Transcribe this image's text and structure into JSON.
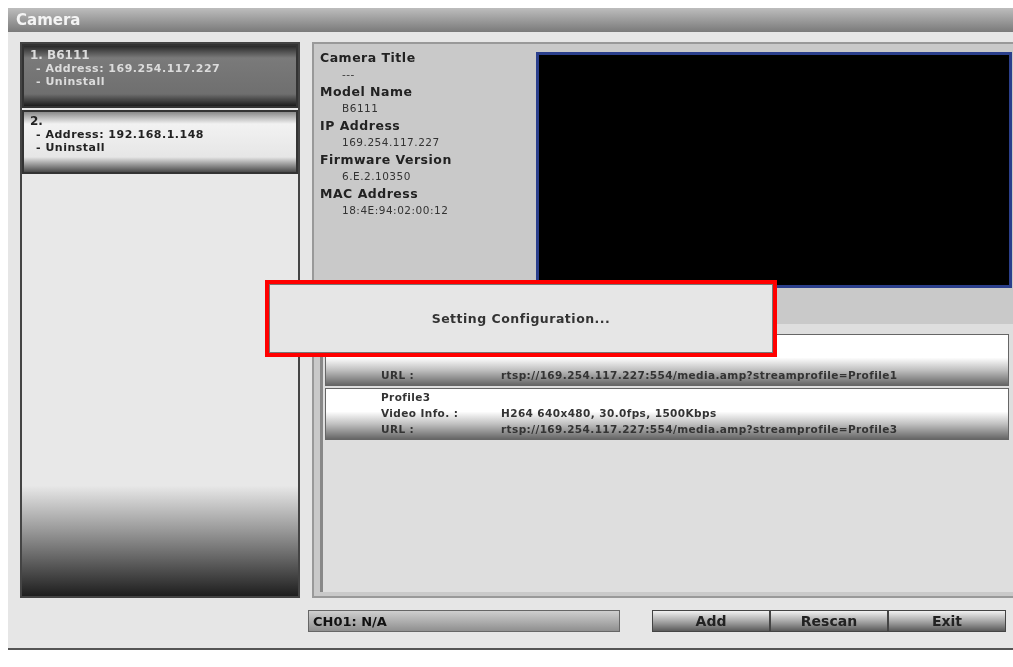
{
  "window": {
    "title": "Camera"
  },
  "cameras": [
    {
      "name": "1. B6111",
      "address": "- Address: 169.254.117.227",
      "action": "- Uninstall",
      "selected": true
    },
    {
      "name": "2.",
      "address": "- Address: 192.168.1.148",
      "action": "- Uninstall",
      "selected": false
    }
  ],
  "details": [
    {
      "label": "Camera Title",
      "value": "---"
    },
    {
      "label": "Model Name",
      "value": "B6111"
    },
    {
      "label": "IP Address",
      "value": "169.254.117.227"
    },
    {
      "label": "Firmware Version",
      "value": "6.E.2.10350"
    },
    {
      "label": "MAC Address",
      "value": "18:4E:94:02:00:12"
    }
  ],
  "profiles": [
    {
      "url_label": "URL :",
      "url": "rtsp://169.254.117.227:554/media.amp?streamprofile=Profile1"
    },
    {
      "name": "Profile3",
      "info_label": "Video Info. :",
      "info": "H264 640x480, 30.0fps, 1500Kbps",
      "url_label": "URL :",
      "url": "rtsp://169.254.117.227:554/media.amp?streamprofile=Profile3"
    }
  ],
  "dialog": {
    "message": "Setting Configuration..."
  },
  "status": "CH01: N/A",
  "buttons": [
    "Add",
    "Rescan",
    "Exit"
  ]
}
